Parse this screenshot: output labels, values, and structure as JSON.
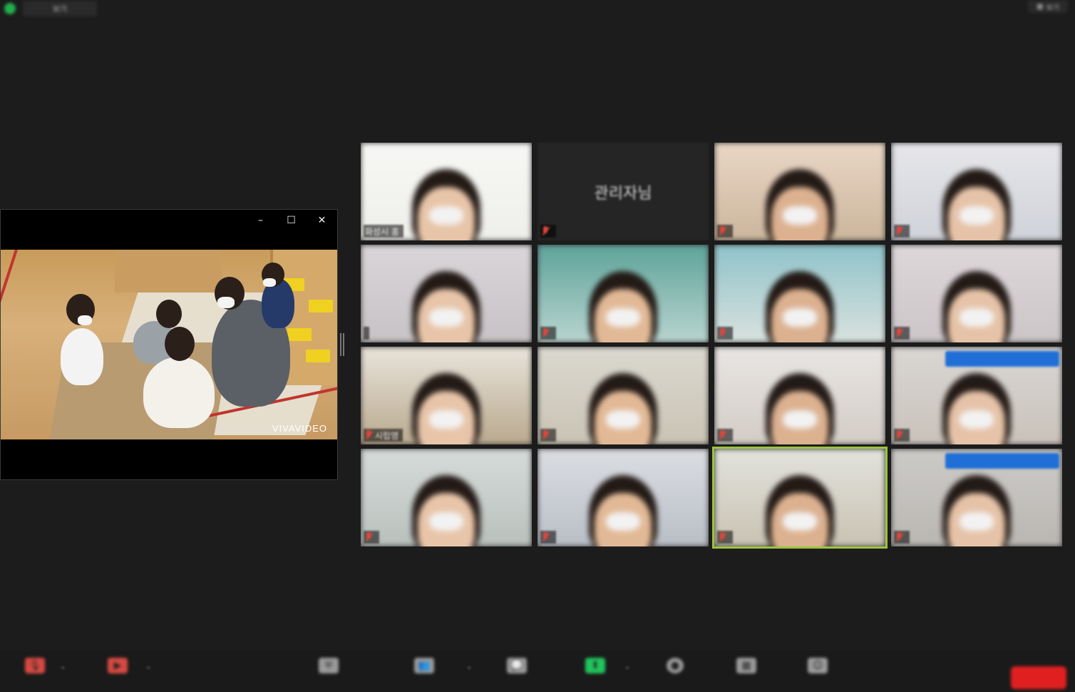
{
  "topbar": {
    "view_label": "보기",
    "right_label": "보기"
  },
  "floating_window": {
    "controls": {
      "minimize": "–",
      "maximize": "☐",
      "close": "✕"
    },
    "watermark": "VIVAVIDEO"
  },
  "gallery": {
    "tiles": [
      {
        "name": "화성시 홍",
        "muted": false
      },
      {
        "name": "",
        "center_name": "관리자님",
        "muted": true
      },
      {
        "name": "",
        "muted": true
      },
      {
        "name": "",
        "muted": true
      },
      {
        "name": "",
        "muted": false
      },
      {
        "name": "",
        "muted": true
      },
      {
        "name": "",
        "muted": true
      },
      {
        "name": "",
        "muted": true
      },
      {
        "name": "시립영",
        "muted": true
      },
      {
        "name": "",
        "muted": true
      },
      {
        "name": "",
        "muted": true
      },
      {
        "name": "",
        "muted": true
      },
      {
        "name": "",
        "muted": true
      },
      {
        "name": "",
        "muted": true
      },
      {
        "name": "",
        "muted": true,
        "active": true
      },
      {
        "name": "",
        "muted": true
      }
    ]
  },
  "toolbar": {
    "items": [
      {
        "icon": "mic-icon",
        "label": ""
      },
      {
        "icon": "video-icon",
        "label": ""
      },
      {
        "icon": "security-icon",
        "label": ""
      },
      {
        "icon": "participants-icon",
        "label": "",
        "count": ""
      },
      {
        "icon": "chat-icon",
        "label": ""
      },
      {
        "icon": "share-screen-icon",
        "label": ""
      },
      {
        "icon": "record-icon",
        "label": ""
      },
      {
        "icon": "rooms-icon",
        "label": ""
      },
      {
        "icon": "reactions-icon",
        "label": ""
      }
    ],
    "end_label": ""
  },
  "colors": {
    "background": "#1c1c1c",
    "active_speaker": "#9bc53d",
    "share_green": "#21c45d",
    "end_red": "#e02020",
    "badge_blue": "#1f6fd6"
  }
}
